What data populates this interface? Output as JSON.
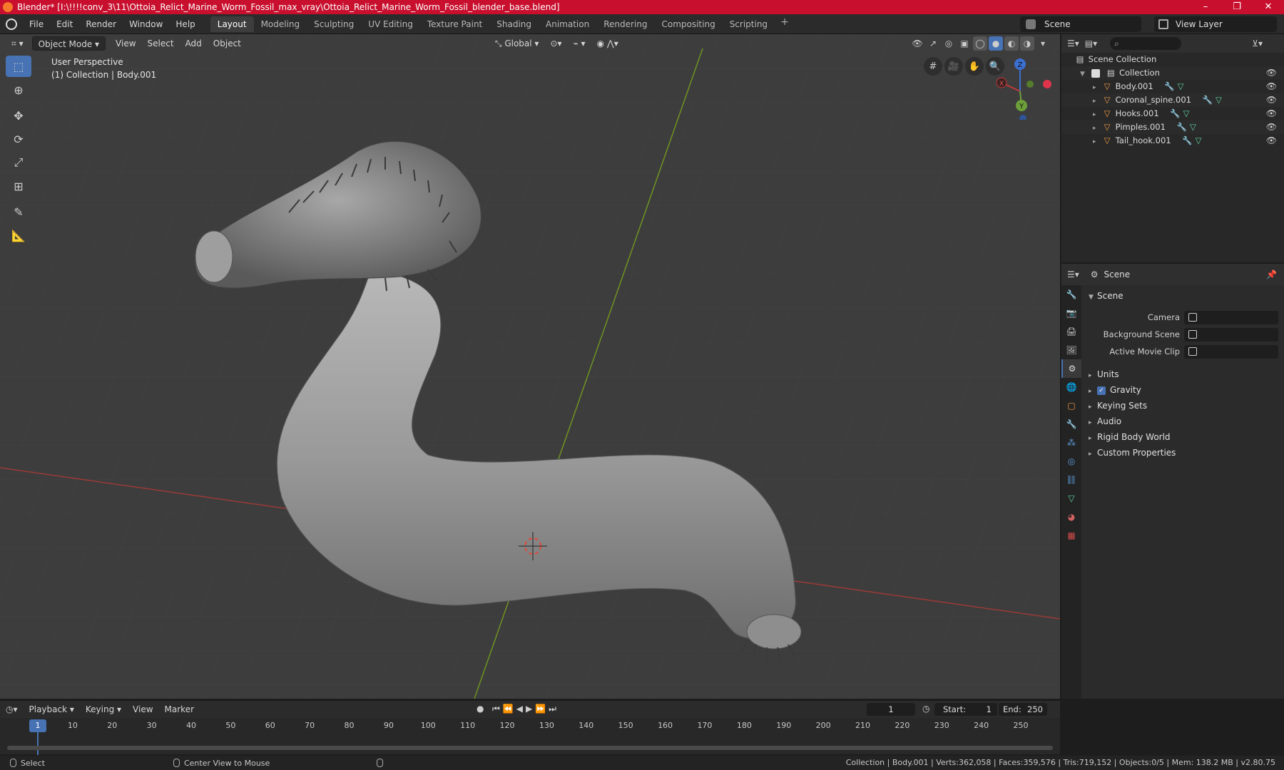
{
  "window": {
    "title": "Blender* [I:\\!!!!conv_3\\11\\Ottoia_Relict_Marine_Worm_Fossil_max_vray\\Ottoia_Relict_Marine_Worm_Fossil_blender_base.blend]",
    "controls": [
      "–",
      "❐",
      "✕"
    ]
  },
  "menu": [
    "File",
    "Edit",
    "Render",
    "Window",
    "Help"
  ],
  "workspaces": [
    "Layout",
    "Modeling",
    "Sculpting",
    "UV Editing",
    "Texture Paint",
    "Shading",
    "Animation",
    "Rendering",
    "Compositing",
    "Scripting"
  ],
  "workspace_add": "+",
  "scene_name": "Scene",
  "view_layer": "View Layer",
  "viewport": {
    "mode": "Object Mode",
    "menus": [
      "View",
      "Select",
      "Add",
      "Object"
    ],
    "transform_orientation": "Global",
    "info_line1": "User Perspective",
    "info_line2": "(1) Collection | Body.001",
    "gizmo": {
      "x": "X",
      "y": "Y",
      "z": "Z"
    }
  },
  "outliner": {
    "root": "Scene Collection",
    "collection": "Collection",
    "objects": [
      "Body.001",
      "Coronal_spine.001",
      "Hooks.001",
      "Pimples.001",
      "Tail_hook.001"
    ]
  },
  "properties": {
    "header": "Scene",
    "panel": "Scene",
    "fields": [
      {
        "label": "Camera"
      },
      {
        "label": "Background Scene"
      },
      {
        "label": "Active Movie Clip"
      }
    ],
    "sections": [
      "Units",
      "Gravity",
      "Keying Sets",
      "Audio",
      "Rigid Body World",
      "Custom Properties"
    ],
    "gravity_checked": true
  },
  "timeline": {
    "menus": [
      "Playback",
      "Keying",
      "View",
      "Marker"
    ],
    "current_frame": "1",
    "start_label": "Start:",
    "start": "1",
    "end_label": "End:",
    "end": "250",
    "ticks": [
      "10",
      "20",
      "30",
      "40",
      "50",
      "60",
      "70",
      "80",
      "90",
      "100",
      "110",
      "120",
      "130",
      "140",
      "150",
      "160",
      "170",
      "180",
      "190",
      "200",
      "210",
      "220",
      "230",
      "240",
      "250"
    ]
  },
  "status": {
    "left": "Select",
    "middle": "Center View to Mouse",
    "stats": "Collection | Body.001 | Verts:362,058 | Faces:359,576 | Tris:719,152 | Objects:0/5 | Mem: 138.2 MB | v2.80.75"
  },
  "colors": {
    "titlebar": "#c8102e",
    "accent": "#4772b3",
    "viewport_bg": "#3d3d3d",
    "x_axis": "#b5443c",
    "y_axis": "#7da325"
  }
}
